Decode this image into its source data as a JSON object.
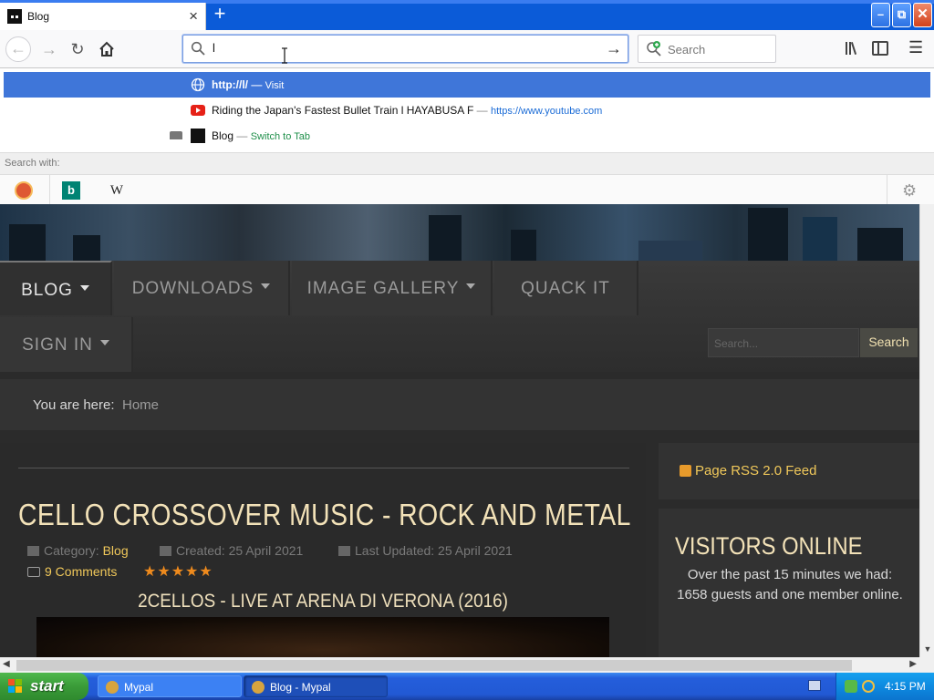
{
  "browser": {
    "tab": {
      "title": "Blog"
    },
    "new_tab_symbol": "+",
    "url_input": {
      "value": "l"
    },
    "search_input": {
      "placeholder": "Search"
    },
    "window_buttons": {
      "minimize": "–",
      "maximize": "⧉",
      "close": "✕"
    }
  },
  "autocomplete": {
    "rows": [
      {
        "title": "http://l/",
        "separator": "—",
        "action": "Visit"
      },
      {
        "title": "Riding the Japan's Fastest Bullet Train l HAYABUSA F",
        "separator": "—",
        "url": "https://www.youtube.com"
      },
      {
        "title": "Blog",
        "separator": "—",
        "action": "Switch to Tab"
      }
    ],
    "search_with_label": "Search with:",
    "engines": [
      "DuckDuckGo",
      "Bing",
      "Wikipedia"
    ],
    "engine_glyphs": {
      "bing": "b",
      "wikipedia": "W"
    }
  },
  "site": {
    "menu": [
      {
        "label": "BLOG"
      },
      {
        "label": "DOWNLOADS"
      },
      {
        "label": "IMAGE GALLERY"
      },
      {
        "label": "QUACK IT"
      },
      {
        "label": "SIGN IN"
      }
    ],
    "search": {
      "placeholder": "Search...",
      "button": "Search"
    },
    "breadcrumb": {
      "prefix": "You are here:",
      "current": "Home"
    },
    "article": {
      "title": "CELLO CROSSOVER MUSIC - ROCK AND METAL",
      "category_label": "Category:",
      "category": "Blog",
      "created": "Created: 25 April 2021",
      "updated": "Last Updated: 25 April 2021",
      "comments": "9 Comments",
      "rating_stars": 5,
      "stars_text": "★★★★★",
      "video_title": "2CELLOS - LIVE AT ARENA DI VERONA (2016)"
    },
    "sidebar": {
      "rss": "Page RSS 2.0 Feed",
      "visitors_title": "VISITORS ONLINE",
      "visitors_text": "Over the past 15 minutes we had: 1658 guests and one member online."
    }
  },
  "taskbar": {
    "start": "start",
    "tasks": [
      {
        "label": "Mypal"
      },
      {
        "label": "Blog - Mypal"
      }
    ],
    "clock": "4:15 PM"
  }
}
